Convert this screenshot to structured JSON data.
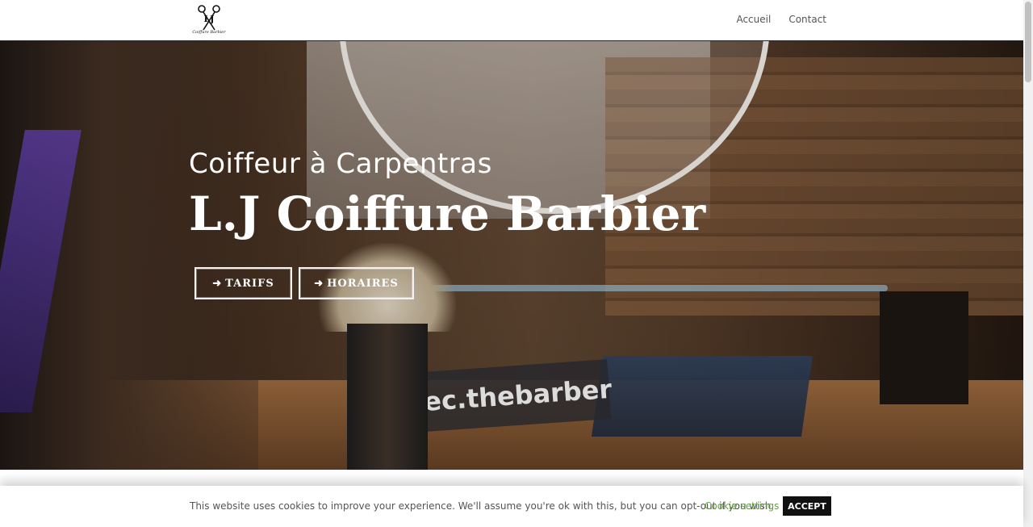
{
  "header": {
    "logo_text": "Coiffure Barbier",
    "nav": [
      {
        "label": "Accueil"
      },
      {
        "label": "Contact"
      }
    ]
  },
  "hero": {
    "subtitle": "Coiffeur à Carpentras",
    "title": "L.J Coiffure Barbier",
    "sign_text": "ec.thebarber",
    "buttons": [
      {
        "label": "TARIFS",
        "icon": "arrow-right-icon"
      },
      {
        "label": "HORAIRES",
        "icon": "arrow-right-icon"
      }
    ]
  },
  "cookie": {
    "text": "This website uses cookies to improve your experience. We'll assume you're ok with this, but you can opt-out if you wish.",
    "settings_label": "Cookie settings",
    "accept_label": "ACCEPT"
  },
  "colors": {
    "cookie_link": "#6aa04a",
    "accept_bg": "#111111",
    "nav_text": "#555555"
  }
}
